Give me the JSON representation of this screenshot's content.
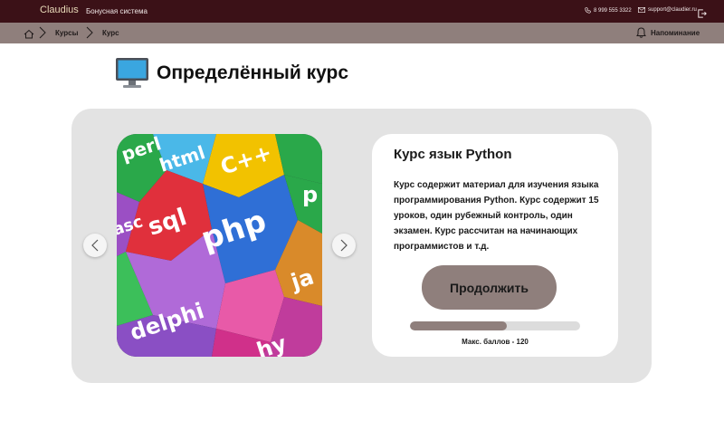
{
  "header": {
    "brand": "Claudius",
    "subtitle": "Бонусная система",
    "phone": "8 999 555 3322",
    "email": "support@claudier.ru"
  },
  "breadcrumb": {
    "items": [
      "Курсы",
      "Курс"
    ],
    "notification_label": "Напоминание"
  },
  "page": {
    "title": "Определённый курс"
  },
  "course": {
    "title": "Курс язык Python",
    "description": "Курс содержит материал для изучения языка программирования Python. Курс содержит 15 уроков, один рубежный контроль, один экзамен. Курс рассчитан на начинающих программистов и т.д.",
    "continue_label": "Продолжить",
    "progress_fraction": 0.57,
    "max_points_label": "Макс. баллов - 120"
  },
  "image_words": [
    "perl",
    "html",
    "C++",
    "sql",
    "php",
    "p",
    "asc",
    "delphi",
    "ja",
    "hy"
  ],
  "colors": {
    "topbar": "#3b1117",
    "breadcrumb_bar": "#8f7f7c",
    "accent": "#8f7f7c",
    "panel": "#e3e3e3"
  }
}
